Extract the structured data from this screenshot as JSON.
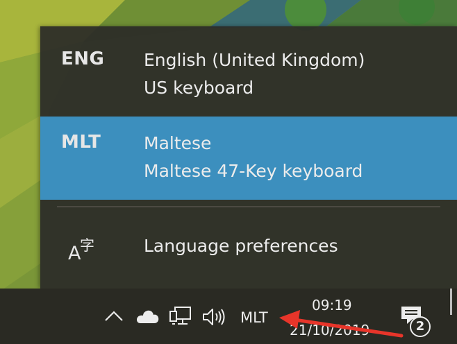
{
  "language_flyout": {
    "languages": [
      {
        "code": "ENG",
        "name": "English (United Kingdom)",
        "keyboard": "US keyboard",
        "selected": false
      },
      {
        "code": "MLT",
        "name": "Maltese",
        "keyboard": "Maltese 47-Key keyboard",
        "selected": true
      }
    ],
    "preferences": {
      "label": "Language preferences",
      "icon": "language-preferences-icon",
      "icon_glyph_a": "A",
      "icon_glyph_cjk": "字"
    }
  },
  "taskbar": {
    "tray_icons": [
      "chevron-up-icon",
      "onedrive-cloud-icon",
      "network-icon",
      "volume-icon"
    ],
    "input_indicator": "MLT",
    "clock": {
      "time": "09:19",
      "date": "21/10/2019"
    },
    "action_center": {
      "icon": "action-center-icon",
      "badge_count": "2"
    }
  },
  "colors": {
    "flyout_bg": "#2b2b28",
    "selected_row": "#3c8fbe",
    "taskbar_bg": "#2a2a23",
    "annotation_arrow": "#e8352a"
  }
}
